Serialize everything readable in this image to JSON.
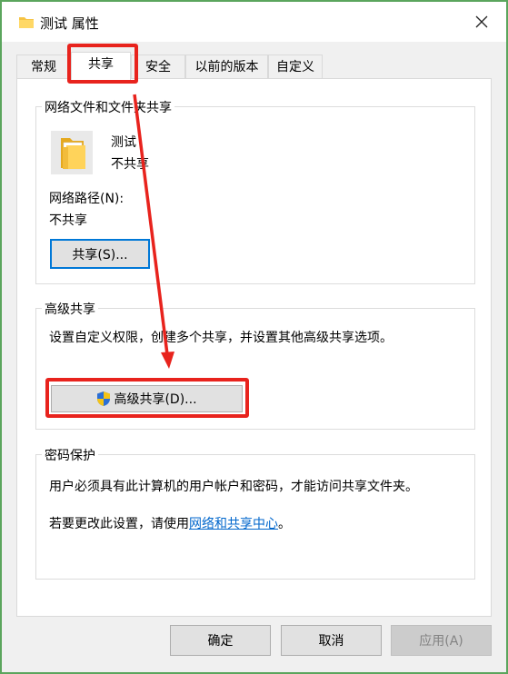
{
  "window": {
    "title": "测试 属性",
    "close_glyph": "✕"
  },
  "tabs": [
    {
      "label": "常规"
    },
    {
      "label": "共享"
    },
    {
      "label": "安全"
    },
    {
      "label": "以前的版本"
    },
    {
      "label": "自定义"
    }
  ],
  "network_share": {
    "group_label": "网络文件和文件夹共享",
    "folder_name": "测试",
    "status": "不共享",
    "path_label": "网络路径(N):",
    "path_value": "不共享",
    "share_button": "共享(S)..."
  },
  "advanced_share": {
    "group_label": "高级共享",
    "description": "设置自定义权限，创建多个共享，并设置其他高级共享选项。",
    "button": "高级共享(D)..."
  },
  "password": {
    "group_label": "密码保护",
    "description": "用户必须具有此计算机的用户帐户和密码，才能访问共享文件夹。",
    "change_prefix": "若要更改此设置，请使用",
    "link": "网络和共享中心",
    "change_suffix": "。"
  },
  "footer": {
    "ok": "确定",
    "cancel": "取消",
    "apply": "应用(A)"
  },
  "colors": {
    "background": "#5ba55d",
    "annotation": "#e8231d",
    "link": "#0066cc",
    "accent": "#0078d7"
  }
}
